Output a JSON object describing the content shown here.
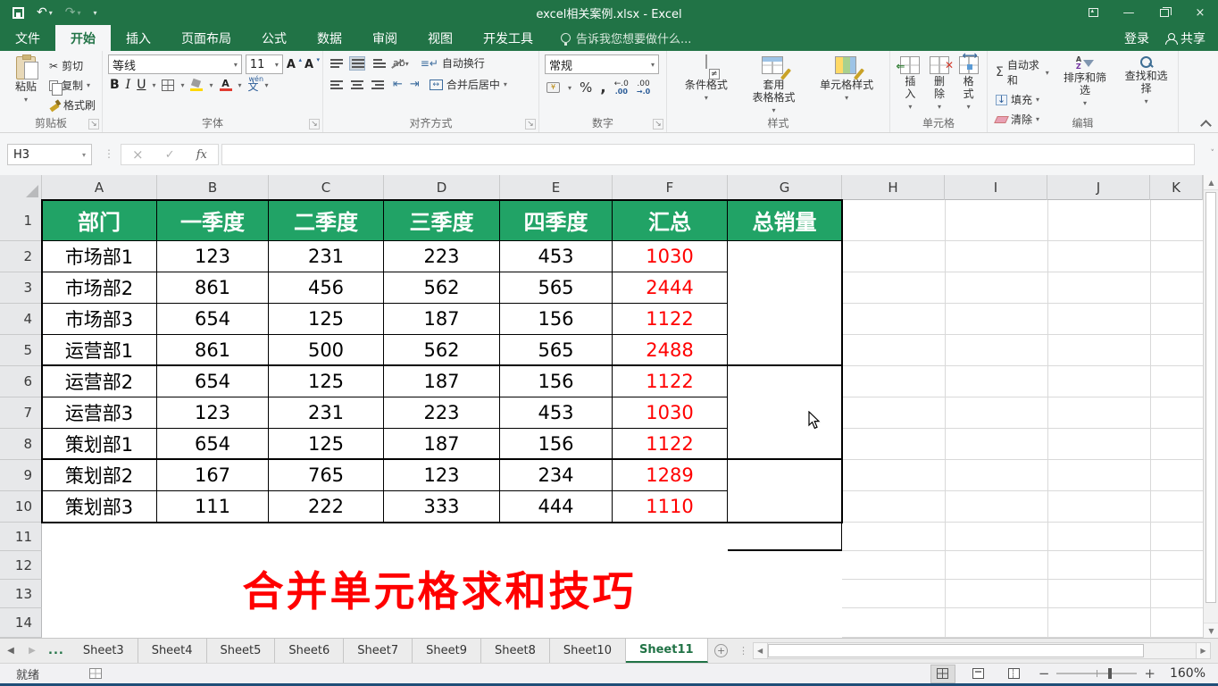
{
  "titlebar": {
    "title": "excel相关案例.xlsx - Excel"
  },
  "ribbon": {
    "tabs": [
      {
        "label": "文件",
        "type": "file"
      },
      {
        "label": "开始",
        "active": true
      },
      {
        "label": "插入"
      },
      {
        "label": "页面布局"
      },
      {
        "label": "公式"
      },
      {
        "label": "数据"
      },
      {
        "label": "审阅"
      },
      {
        "label": "视图"
      },
      {
        "label": "开发工具"
      }
    ],
    "tell_me": "告诉我您想要做什么...",
    "sign_in": "登录",
    "share": "共享",
    "clipboard": {
      "label": "剪贴板",
      "paste": "粘贴",
      "cut": "剪切",
      "copy": "复制",
      "format_painter": "格式刷"
    },
    "font": {
      "label": "字体",
      "name": "等线",
      "size": "11",
      "bold": "B",
      "italic": "I",
      "underline": "U",
      "phonetic": "文",
      "phonetic_hint": "wén",
      "grow": "A",
      "shrink": "A"
    },
    "alignment": {
      "label": "对齐方式",
      "wrap_text": "自动换行",
      "merge_center": "合并后居中",
      "angle": "ab"
    },
    "number": {
      "label": "数字",
      "format": "常规",
      "percent": "%",
      "comma": ",",
      "inc_decimal": "←.0",
      "dec_decimal": ".00",
      "inc_sub": ".00",
      "dec_sub": "→.0"
    },
    "styles": {
      "label": "样式",
      "conditional": "条件格式",
      "format_table": "套用\n表格格式",
      "cell_styles": "单元格样式",
      "ne_badge": "≠"
    },
    "cells": {
      "label": "单元格",
      "insert": "插入",
      "delete": "删除",
      "format": "格式"
    },
    "editing": {
      "label": "编辑",
      "sigma": "Σ",
      "autosum": "自动求和",
      "fill": "填充",
      "clear": "清除",
      "sort_filter": "排序和筛选",
      "find_select": "查找和选择",
      "az_a": "A",
      "az_z": "Z"
    }
  },
  "formula_bar": {
    "name_box": "H3",
    "formula": "",
    "fx": "fx",
    "cancel": "×",
    "enter": "✓"
  },
  "grid": {
    "column_letters": [
      "A",
      "B",
      "C",
      "D",
      "E",
      "F",
      "G",
      "H",
      "I",
      "J",
      "K"
    ],
    "row_numbers": [
      "1",
      "2",
      "3",
      "4",
      "5",
      "6",
      "7",
      "8",
      "9",
      "10",
      "11",
      "12",
      "13",
      "14"
    ],
    "table": {
      "headers": [
        "部门",
        "一季度",
        "二季度",
        "三季度",
        "四季度",
        "汇总",
        "总销量"
      ],
      "rows": [
        [
          "市场部1",
          "123",
          "231",
          "223",
          "453",
          "1030"
        ],
        [
          "市场部2",
          "861",
          "456",
          "562",
          "565",
          "2444"
        ],
        [
          "市场部3",
          "654",
          "125",
          "187",
          "156",
          "1122"
        ],
        [
          "运营部1",
          "861",
          "500",
          "562",
          "565",
          "2488"
        ],
        [
          "运营部2",
          "654",
          "125",
          "187",
          "156",
          "1122"
        ],
        [
          "运营部3",
          "123",
          "231",
          "223",
          "453",
          "1030"
        ],
        [
          "策划部1",
          "654",
          "125",
          "187",
          "156",
          "1122"
        ],
        [
          "策划部2",
          "167",
          "765",
          "123",
          "234",
          "1289"
        ],
        [
          "策划部3",
          "111",
          "222",
          "333",
          "444",
          "1110"
        ]
      ]
    },
    "banner": "合并单元格求和技巧"
  },
  "sheet_bar": {
    "overflow": "...",
    "tabs": [
      "Sheet3",
      "Sheet4",
      "Sheet5",
      "Sheet6",
      "Sheet7",
      "Sheet9",
      "Sheet8",
      "Sheet10",
      "Sheet11"
    ],
    "active": "Sheet11"
  },
  "status_bar": {
    "ready": "就绪",
    "zoom_level": "160%"
  },
  "colors": {
    "excel_green": "#217346",
    "table_header_green": "#21a366",
    "value_red": "#ff0000"
  }
}
